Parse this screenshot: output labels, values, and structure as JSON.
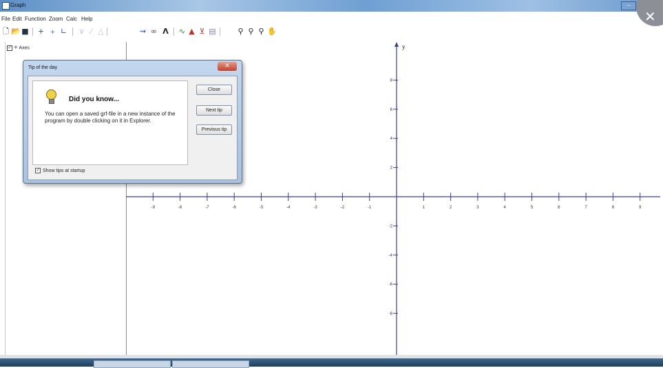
{
  "window": {
    "title": "Graph",
    "minimize_glyph": "–",
    "close_glyph": "✕"
  },
  "menu": [
    "File",
    "Edit",
    "Function",
    "Zoom",
    "Calc",
    "Help"
  ],
  "toolbar": {
    "icons": [
      "new-file-icon",
      "open-file-icon",
      "save-icon",
      "insert-function-icon",
      "insert-series-icon",
      "insert-point-icon",
      "tangent-icon",
      "shading-icon",
      "relation-icon",
      "text-label-icon",
      "evaluate-icon",
      "zoom-in-icon",
      "zoom-out-icon",
      "zoom-window-icon",
      "pan-icon"
    ]
  },
  "tree": {
    "axes_label": "Axes"
  },
  "dialog": {
    "title": "Tip of the day",
    "heading": "Did you know...",
    "tip": "You can open a saved grf-file in a new instance of the program by double clicking on it in Explorer.",
    "buttons": {
      "close": "Close",
      "next": "Next tip",
      "previous": "Previous tip"
    },
    "show_tips_label": "Show tips at startup",
    "show_tips_checked": true
  },
  "graph": {
    "y_axis_label": "y",
    "x_ticks": [
      "-9",
      "-8",
      "-7",
      "-6",
      "-5",
      "-4",
      "-3",
      "-2",
      "-1",
      "1",
      "2",
      "3",
      "4",
      "5",
      "6",
      "7",
      "8",
      "9"
    ],
    "y_ticks": [
      "8",
      "6",
      "4",
      "2",
      "-2",
      "-4",
      "-6",
      "-8"
    ],
    "axis_color": "#3b3b9a"
  }
}
